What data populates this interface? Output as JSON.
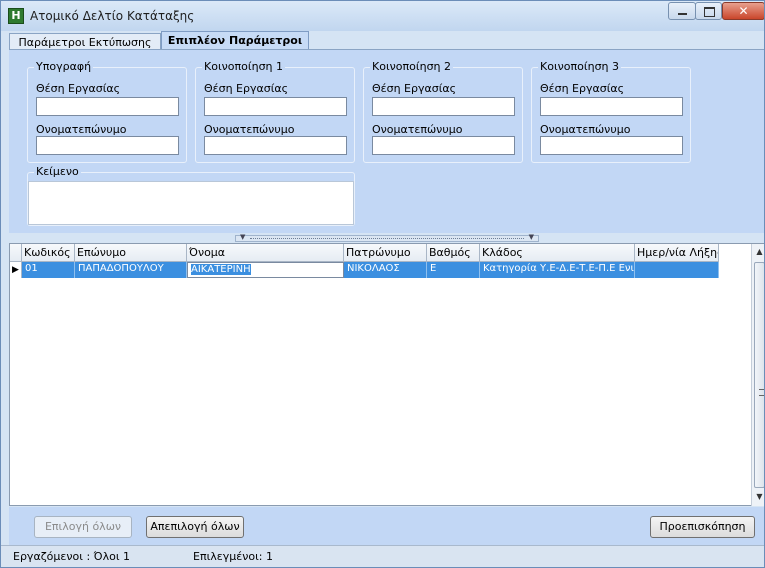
{
  "window": {
    "title": "Ατομικό Δελτίο Κατάταξης",
    "app_icon_letter": "H"
  },
  "tabs": [
    {
      "label": "Παράμετροι Εκτύπωσης",
      "active": false
    },
    {
      "label": "Επιπλέον Παράμετροι",
      "active": true
    }
  ],
  "groups": [
    {
      "legend": "Υπογραφή",
      "position_label": "Θέση Εργασίας",
      "name_label": "Ονοματεπώνυμο",
      "position_value": "",
      "name_value": ""
    },
    {
      "legend": "Κοινοποίηση 1",
      "position_label": "Θέση Εργασίας",
      "name_label": "Ονοματεπώνυμο",
      "position_value": "",
      "name_value": ""
    },
    {
      "legend": "Κοινοποίηση 2",
      "position_label": "Θέση Εργασίας",
      "name_label": "Ονοματεπώνυμο",
      "position_value": "",
      "name_value": ""
    },
    {
      "legend": "Κοινοποίηση 3",
      "position_label": "Θέση Εργασίας",
      "name_label": "Ονοματεπώνυμο",
      "position_value": "",
      "name_value": ""
    }
  ],
  "text_group": {
    "legend": "Κείμενο",
    "value": ""
  },
  "grid": {
    "columns": [
      "Κωδικός",
      "Επώνυμο",
      "Όνομα",
      "Πατρώνυμο",
      "Βαθμός",
      "Κλάδος",
      "Ημερ/νία Λήξης"
    ],
    "rows": [
      [
        "01",
        "ΠΑΠΑΔΟΠΟΥΛΟΥ",
        "ΑΙΚΑΤΕΡΙΝΗ",
        "ΝΙΚΟΛΑΟΣ",
        "Ε",
        "Κατηγορία Υ.Ε-Δ.Ε-Τ.Ε-Π.Ε Ενιαίος",
        ""
      ]
    ],
    "selected_row": 0,
    "row_indicator": "▶"
  },
  "buttons": {
    "select_all": "Επιλογή όλων",
    "deselect_all": "Απεπιλογή όλων",
    "preview": "Προεπισκόπηση"
  },
  "status": {
    "employees": "Εργαζόμενοι :  Όλοι 1",
    "selected": "Επιλεγμένοι: 1"
  },
  "colors": {
    "selection": "#3b8fe0",
    "pane": "#c2d7f5"
  },
  "icons": {
    "minimize": "minimize-icon",
    "maximize": "maximize-icon",
    "close": "close-icon",
    "scroll_up": "chevron-up-icon",
    "scroll_down": "chevron-down-icon"
  }
}
